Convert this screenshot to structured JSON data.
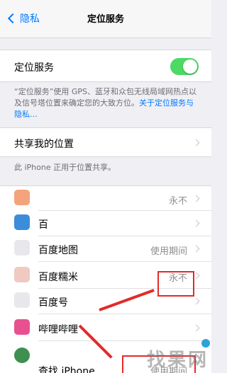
{
  "nav": {
    "back_label": "隐私",
    "title": "定位服务"
  },
  "location_services": {
    "label": "定位服务",
    "enabled": true,
    "description": "“定位服务”使用 GPS、蓝牙和众包无线局域网热点以及信号塔位置来确定您的大致方位。",
    "link": "关于定位服务与隐私..."
  },
  "share": {
    "label": "共享我的位置",
    "footer": "此 iPhone 正用于位置共享。"
  },
  "apps": [
    {
      "name": "",
      "status": "永不",
      "icon_color": "#f4a37a"
    },
    {
      "name": "百",
      "status": "",
      "icon_color": "#3b8ddb"
    },
    {
      "name": "百度地图",
      "status": "使用期间",
      "icon_color": "#e8e8ec"
    },
    {
      "name": "百度糯米",
      "status": "永不",
      "icon_color": "#f0c9c0"
    },
    {
      "name": "百度号",
      "status": "",
      "icon_color": "#e8e8ec"
    },
    {
      "name": "哔哩哔哩",
      "status": "",
      "icon_color": "#e8518f"
    },
    {
      "name": "查找 iPhone",
      "status": "使用期间",
      "icon_color": "#3f8f4f"
    }
  ],
  "colors": {
    "accent": "#007aff",
    "toggle_on": "#4cd964",
    "annotation_red": "#e32a2a"
  },
  "watermark": "找果网"
}
